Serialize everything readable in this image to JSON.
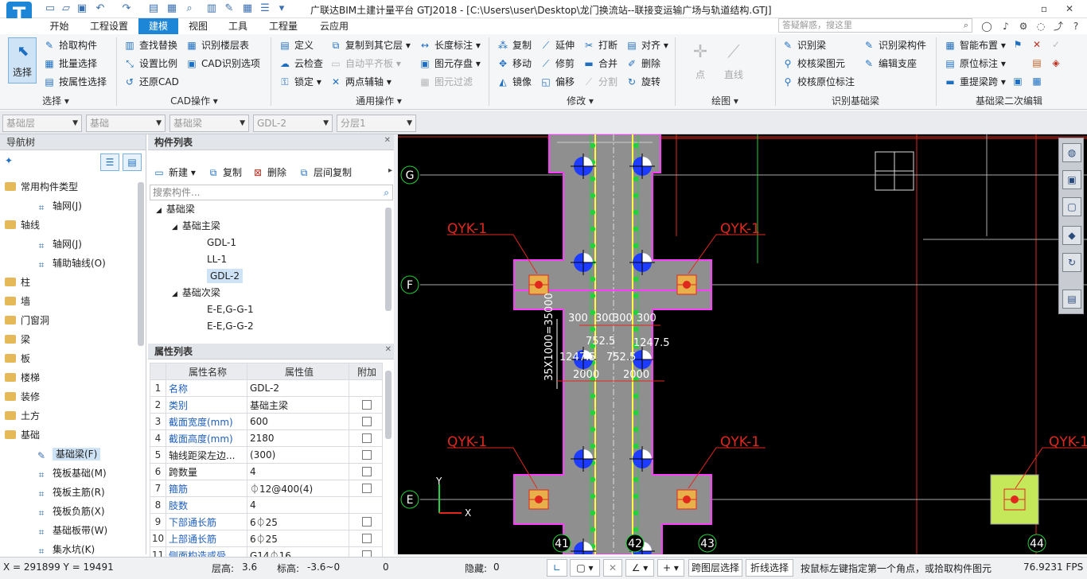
{
  "window": {
    "title": "广联达BIM土建计量平台 GTJ2018 - [C:\\Users\\user\\Desktop\\龙门换流站--联接变运输广场与轨道结构.GTJ]",
    "logo_letter": "T"
  },
  "menu_tabs": [
    "开始",
    "工程设置",
    "建模",
    "视图",
    "工具",
    "工程量",
    "云应用"
  ],
  "search_placeholder": "答疑解惑，搜这里",
  "ribbon": {
    "select": {
      "label": "选择",
      "group": "选择 ▾"
    },
    "pick": [
      "拾取构件",
      "批量选择",
      "按属性选择"
    ],
    "cad": [
      "查找替换",
      "识别楼层表",
      "设置比例",
      "CAD识别选项",
      "还原CAD"
    ],
    "cad_group": "CAD操作 ▾",
    "general": [
      "定义",
      "复制到其它层 ▾",
      "长度标注 ▾",
      "云检查",
      "自动平齐板 ▾",
      "图元存盘 ▾",
      "锁定 ▾",
      "两点辅轴 ▾",
      "图元过滤"
    ],
    "general_group": "通用操作 ▾",
    "modify": [
      "复制",
      "延伸",
      "打断",
      "对齐 ▾",
      "移动",
      "修剪",
      "合并",
      "删除",
      "镜像",
      "偏移",
      "分割",
      "旋转"
    ],
    "modify_group": "修改 ▾",
    "draw": [
      "点",
      "直线"
    ],
    "draw_group": "绘图 ▾",
    "recognize": [
      "识别梁",
      "识别梁构件",
      "校核梁图元",
      "编辑支座",
      "校核原位标注"
    ],
    "recognize_group": "识别基础梁",
    "edit": [
      "智能布置 ▾",
      "原位标注 ▾",
      "重提梁跨 ▾"
    ],
    "edit_group": "基础梁二次编辑"
  },
  "filters": [
    "基础层",
    "基础",
    "基础梁",
    "GDL-2",
    "分层1"
  ],
  "nav": {
    "title": "导航树",
    "items": [
      {
        "label": "常用构件类型",
        "type": "folder"
      },
      {
        "label": "轴网(J)",
        "type": "child"
      },
      {
        "label": "轴线",
        "type": "folder"
      },
      {
        "label": "轴网(J)",
        "type": "child"
      },
      {
        "label": "辅助轴线(O)",
        "type": "child"
      },
      {
        "label": "柱",
        "type": "folder"
      },
      {
        "label": "墙",
        "type": "folder"
      },
      {
        "label": "门窗洞",
        "type": "folder"
      },
      {
        "label": "梁",
        "type": "folder"
      },
      {
        "label": "板",
        "type": "folder"
      },
      {
        "label": "楼梯",
        "type": "folder"
      },
      {
        "label": "装修",
        "type": "folder"
      },
      {
        "label": "土方",
        "type": "folder"
      },
      {
        "label": "基础",
        "type": "folder"
      },
      {
        "label": "基础梁(F)",
        "type": "child",
        "selected": true
      },
      {
        "label": "筏板基础(M)",
        "type": "child"
      },
      {
        "label": "筏板主筋(R)",
        "type": "child"
      },
      {
        "label": "筏板负筋(X)",
        "type": "child"
      },
      {
        "label": "基础板带(W)",
        "type": "child"
      },
      {
        "label": "集水坑(K)",
        "type": "child"
      }
    ]
  },
  "components": {
    "title": "构件列表",
    "toolbar": [
      "新建 ▾",
      "复制",
      "删除",
      "层间复制"
    ],
    "search_placeholder": "搜索构件...",
    "tree": [
      {
        "label": "基础梁",
        "level": 0
      },
      {
        "label": "基础主梁",
        "level": 1
      },
      {
        "label": "GDL-1",
        "level": 2
      },
      {
        "label": "LL-1",
        "level": 2
      },
      {
        "label": "GDL-2",
        "level": 2,
        "selected": true
      },
      {
        "label": "基础次梁",
        "level": 1
      },
      {
        "label": "E-E,G-G-1",
        "level": 2
      },
      {
        "label": "E-E,G-G-2",
        "level": 2
      }
    ]
  },
  "properties": {
    "title": "属性列表",
    "headers": [
      "属性名称",
      "属性值",
      "附加"
    ],
    "rows": [
      {
        "no": "1",
        "name": "名称",
        "value": "GDL-2",
        "blue": true,
        "cb": false
      },
      {
        "no": "2",
        "name": "类别",
        "value": "基础主梁",
        "blue": true,
        "cb": true
      },
      {
        "no": "3",
        "name": "截面宽度(mm)",
        "value": "600",
        "blue": true,
        "cb": true
      },
      {
        "no": "4",
        "name": "截面高度(mm)",
        "value": "2180",
        "blue": true,
        "cb": true
      },
      {
        "no": "5",
        "name": "轴线距梁左边...",
        "value": "(300)",
        "blue": false,
        "cb": true
      },
      {
        "no": "6",
        "name": "跨数量",
        "value": "4",
        "blue": false,
        "cb": true
      },
      {
        "no": "7",
        "name": "箍筋",
        "value": "⏀12@400(4)",
        "blue": true,
        "cb": true
      },
      {
        "no": "8",
        "name": "肢数",
        "value": "4",
        "blue": true,
        "cb": false
      },
      {
        "no": "9",
        "name": "下部通长筋",
        "value": "6⏀25",
        "blue": true,
        "cb": true
      },
      {
        "no": "10",
        "name": "上部通长筋",
        "value": "6⏀25",
        "blue": true,
        "cb": true
      },
      {
        "no": "11",
        "name": "侧面构造或受...",
        "value": "G14⏀16",
        "blue": true,
        "cb": true
      }
    ]
  },
  "drawing": {
    "axis_labels": [
      "G",
      "F",
      "E",
      "41",
      "42",
      "43",
      "44"
    ],
    "pile_labels": [
      "QYK-1",
      "QYK-1",
      "QYK-1",
      "QYK-1",
      "QYK-1"
    ],
    "dims": [
      "300",
      "300",
      "300",
      "300",
      "752.5",
      "752.5",
      "1247.5",
      "1247.5",
      "2000",
      "2000",
      "35X1000=35000"
    ],
    "ucs": [
      "Y",
      "X"
    ]
  },
  "status": {
    "coords": "X = 291899 Y = 19491",
    "floor_height_label": "层高:",
    "floor_height": "3.6",
    "elevation_label": "标高:",
    "elevation": "-3.6~0",
    "zero": "0",
    "hidden_label": "隐藏:",
    "hidden": "0",
    "btn_cross_layer": "跨图层选择",
    "btn_polyline": "折线选择",
    "hint": "按鼠标左键指定第一个角点，或拾取构件图元",
    "fps": "76.9231 FPS"
  },
  "colors": {
    "accent": "#1e86d6",
    "pile_fill": "#e8b04a",
    "beam_fill": "#8f8f8f",
    "pink": "#ff3cff",
    "red": "#e0281e",
    "green": "#22d23c",
    "yellow": "#ffff40"
  }
}
